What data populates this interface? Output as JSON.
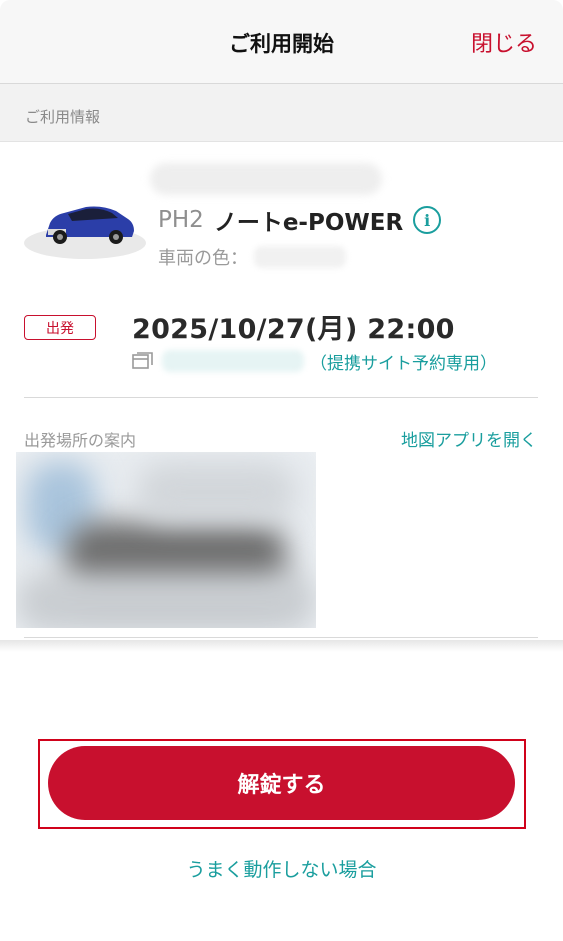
{
  "header": {
    "title": "ご利用開始",
    "close_label": "閉じる"
  },
  "section": {
    "label": "ご利用情報"
  },
  "car": {
    "code": "PH2",
    "name": "ノートe-POWER",
    "color_label": "車両の色：",
    "info_icon": "info-icon"
  },
  "departure": {
    "badge": "出発",
    "datetime": "2025/10/27(月) 22:00",
    "site_note": "（提携サイト予約専用）"
  },
  "location": {
    "label": "出発場所の案内",
    "map_link": "地図アプリを開く"
  },
  "actions": {
    "unlock_label": "解錠する",
    "help_link": "うまく動作しない場合"
  },
  "colors": {
    "brand_red": "#c8102e",
    "accent_teal": "#1a9e9e",
    "header_bg": "#f7f7f7"
  }
}
